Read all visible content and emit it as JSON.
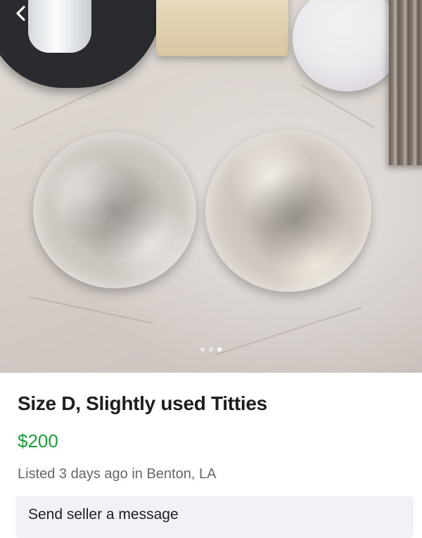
{
  "nav": {
    "back_icon": "chevron-left-icon"
  },
  "photo": {
    "carousel_total": 3,
    "carousel_active": 3
  },
  "listing": {
    "title": "Size D, Slightly used Titties",
    "price": "$200",
    "meta": "Listed 3 days ago in Benton, LA",
    "price_color": "#1a9e3a"
  },
  "actions": {
    "message_label": "Send seller a message"
  }
}
